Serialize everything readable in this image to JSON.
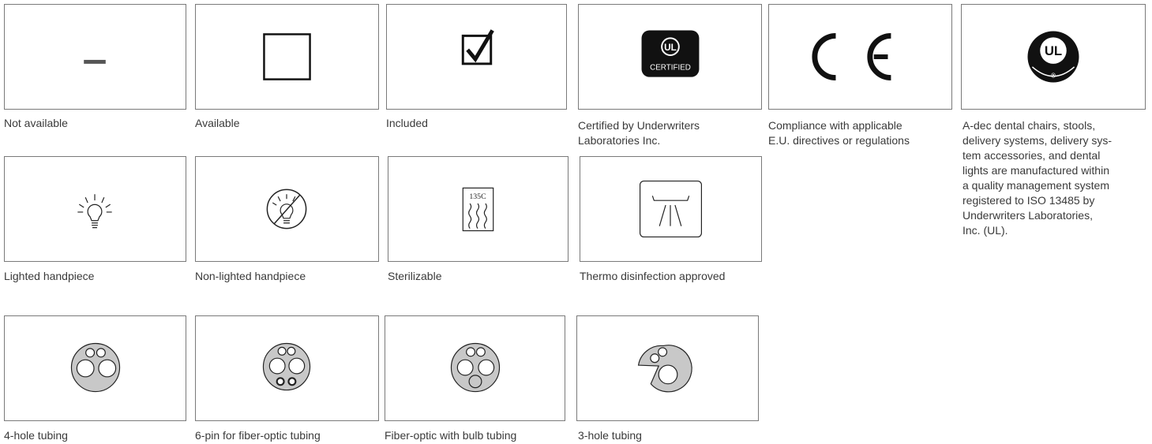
{
  "legend": {
    "not_available": "Not available",
    "available": "Available",
    "included": "Included",
    "ul_certified": [
      "Certified by Underwriters",
      "Laboratories Inc."
    ],
    "ul_certified_badge": "CERTIFIED",
    "ce": [
      "Compliance with applicable",
      "E.U. directives or regulations"
    ],
    "ul_registered": [
      "A-dec dental chairs, stools,",
      "delivery systems, delivery sys-",
      "tem accessories, and dental",
      "lights are manufactured within",
      "a quality management system",
      "registered to ISO 13485 by",
      "Underwriters Laboratories,",
      "Inc. (UL)."
    ],
    "lighted_handpiece": "Lighted handpiece",
    "non_lighted_handpiece": "Non-lighted handpiece",
    "sterilizable": "Sterilizable",
    "sterilizable_temp": "135C",
    "thermo_disinfection": "Thermo disinfection approved",
    "tubing_4_hole": "4-hole tubing",
    "tubing_6_pin": "6-pin for fiber-optic tubing",
    "tubing_fiber_bulb": "Fiber-optic with bulb tubing",
    "tubing_3_hole": "3-hole tubing"
  },
  "icons": {
    "not_available": "dash-icon",
    "available": "empty-checkbox-icon",
    "included": "checked-checkbox-icon",
    "ul_certified": "ul-certified-mark-icon",
    "ce": "ce-mark-icon",
    "ul_registered": "ul-registered-firm-icon",
    "lighted_handpiece": "light-bulb-icon",
    "non_lighted_handpiece": "no-light-bulb-icon",
    "sterilizable": "steam-sterilization-icon",
    "thermo_disinfection": "thermo-disinfection-icon",
    "tubing_4_hole": "four-hole-connector-icon",
    "tubing_6_pin": "six-pin-connector-icon",
    "tubing_fiber_bulb": "fiber-optic-bulb-connector-icon",
    "tubing_3_hole": "three-hole-connector-icon"
  }
}
